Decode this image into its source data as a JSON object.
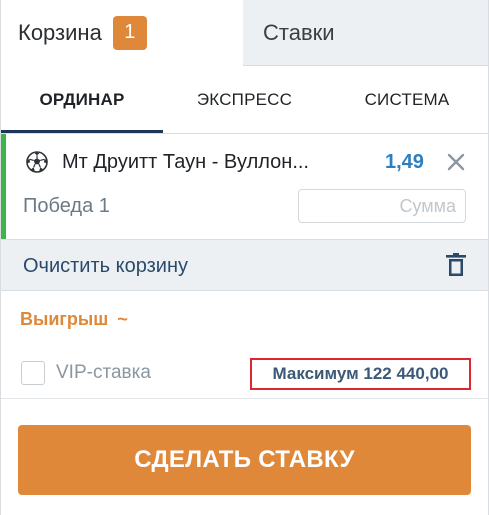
{
  "tabs": {
    "basket_label": "Корзина",
    "basket_count": "1",
    "bets_label": "Ставки"
  },
  "bet_types": [
    "ОРДИНАР",
    "ЭКСПРЕСС",
    "СИСТЕМА"
  ],
  "bet": {
    "sport_icon": "soccer-ball-icon",
    "match": "Мт Друитт Таун - Вуллон...",
    "odds": "1,49",
    "outcome": "Победа 1",
    "stake_placeholder": "Сумма",
    "stake_value": ""
  },
  "clear_basket_label": "Очистить корзину",
  "winnings_label": "Выигрыш",
  "winnings_toggle": "~",
  "vip": {
    "label": "VIP-ставка",
    "checked": false
  },
  "max_label": "Максимум 122 440,00",
  "place_bet_label": "СДЕЛАТЬ СТАВКУ",
  "colors": {
    "accent_orange": "#e0883a",
    "odds_blue": "#2d7fc1",
    "active_green": "#3cb44a",
    "highlight_red": "#d9282f",
    "underline_navy": "#1d3557"
  }
}
